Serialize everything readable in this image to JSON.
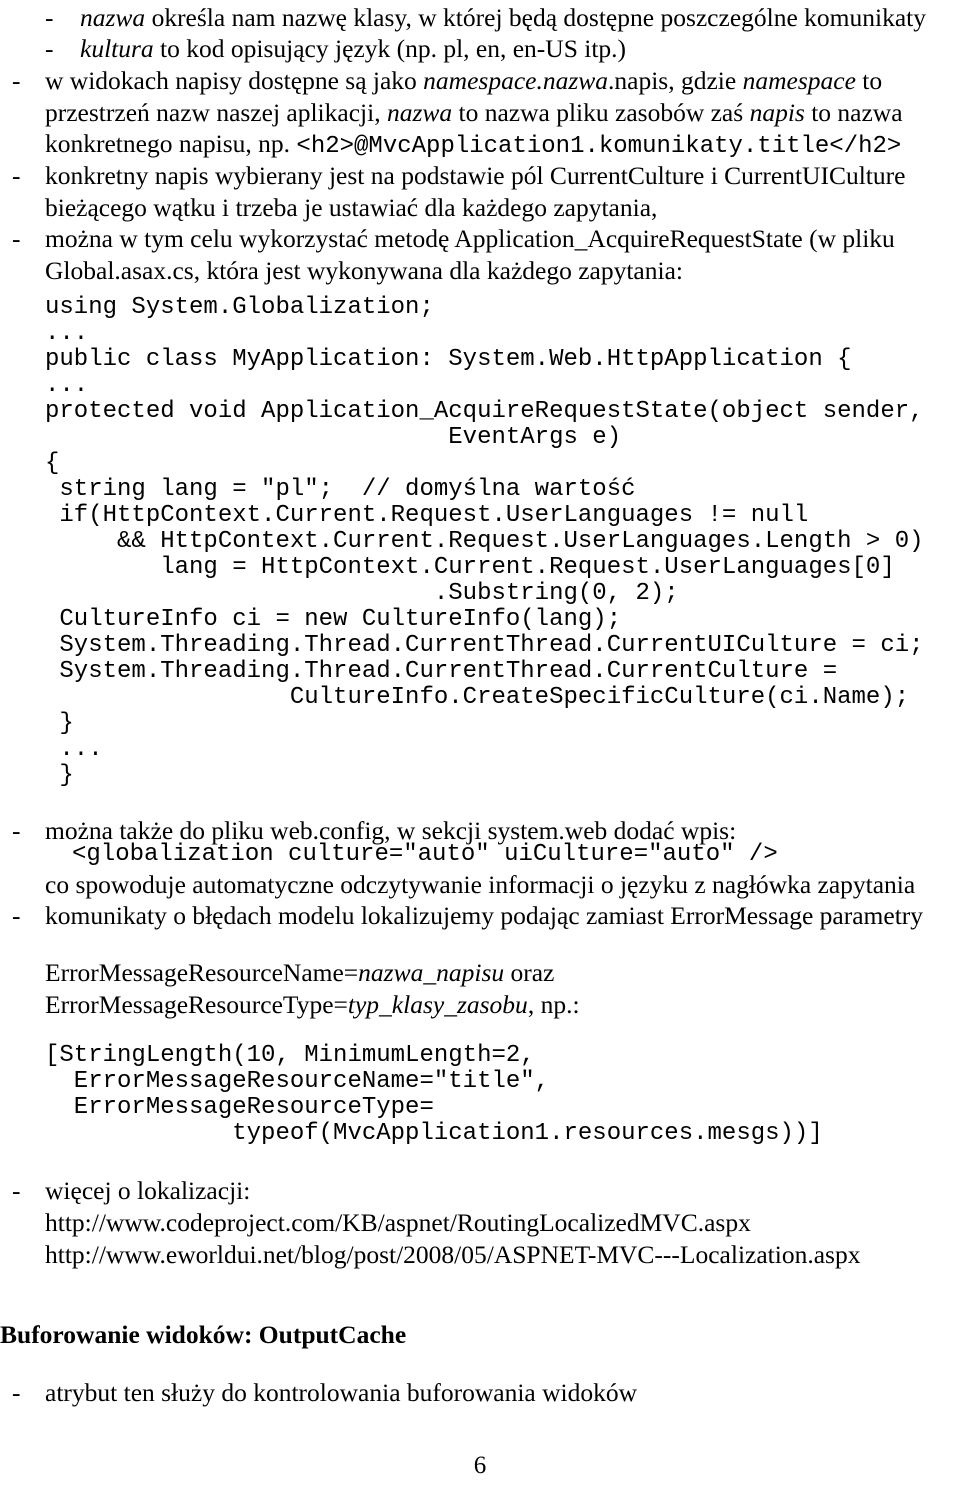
{
  "page": {
    "number": "6",
    "language": "pl"
  },
  "blocks": {
    "b1": {
      "dash": "-",
      "em1": "nazwa",
      "rest": " określa nam nazwę klasy, w której będą dostępne poszczególne komunikaty"
    },
    "b2": {
      "dash": "-",
      "em1": "kultura",
      "rest": " to kod opisujący język (np. pl, en, en-US itp.)"
    },
    "b3": {
      "dash": "-",
      "part1": "w widokach napisy dostępne są jako ",
      "em1": "namespace.nazwa",
      "part2": ".napis, gdzie ",
      "em2": "namespace",
      "part3": " to przestrzeń nazw naszej aplikacji, ",
      "em3": "nazwa",
      "part4": " to nazwa pliku zasobów zaś ",
      "em4": "napis",
      "part5": " to nazwa konkretnego napisu, np. ",
      "code1": "<h2>@MvcApplication1.komunikaty.title</h2>"
    },
    "b4": {
      "dash": "-",
      "text": "konkretny napis wybierany jest na podstawie pól CurrentCulture i CurrentUICulture bieżącego wątku i trzeba je ustawiać dla każdego zapytania,"
    },
    "b5": {
      "dash": "-",
      "text": "można w tym celu wykorzystać metodę Application_AcquireRequestState (w pliku Global.asax.cs, która jest wykonywana dla każdego zapytania:"
    },
    "code_block_1": {
      "lines": [
        "using System.Globalization;",
        "...",
        "public class MyApplication: System.Web.HttpApplication {",
        "...",
        "protected void Application_AcquireRequestState(object sender,",
        "                            EventArgs e)",
        "{",
        " string lang = \"pl\";  // domyślna wartość",
        " if(HttpContext.Current.Request.UserLanguages != null",
        "     && HttpContext.Current.Request.UserLanguages.Length > 0)",
        "        lang = HttpContext.Current.Request.UserLanguages[0]",
        "                           .Substring(0, 2);",
        " CultureInfo ci = new CultureInfo(lang);",
        " System.Threading.Thread.CurrentThread.CurrentUICulture = ci;",
        " System.Threading.Thread.CurrentThread.CurrentCulture =",
        "                 CultureInfo.CreateSpecificCulture(ci.Name);",
        " }",
        " ...",
        " }"
      ]
    },
    "b6": {
      "dash": "-",
      "text": "można także do pliku web.config, w sekcji system.web dodać wpis:"
    },
    "code_inline_1": "<globalization culture=\"auto\" uiCulture=\"auto\" />",
    "b6_after": "co spowoduje automatyczne odczytywanie informacji o języku z nagłówka zapytania",
    "b7": {
      "dash": "-",
      "text": "komunikaty o błędach modelu lokalizujemy podając zamiast ErrorMessage parametry"
    },
    "params": {
      "line1_pre": "ErrorMessageResourceName=",
      "line1_em": "nazwa_napisu",
      "line1_post": " oraz",
      "line2_pre": "ErrorMessageResourceType=",
      "line2_em": "typ_klasy_zasobu",
      "line2_post": ", np.:"
    },
    "code_block_2": {
      "lines": [
        "[StringLength(10, MinimumLength=2,",
        "  ErrorMessageResourceName=\"title\",",
        "  ErrorMessageResourceType=",
        "             typeof(MvcApplication1.resources.mesgs))]"
      ]
    },
    "b8": {
      "dash": "-",
      "text": "więcej o lokalizacji:"
    },
    "links": [
      "http://www.codeproject.com/KB/aspnet/RoutingLocalizedMVC.aspx",
      "http://www.eworldui.net/blog/post/2008/05/ASPNET-MVC---Localization.aspx"
    ],
    "section_heading": "Buforowanie widoków: OutputCache",
    "b9": {
      "dash": "-",
      "text": "atrybut ten służy do kontrolowania buforowania widoków"
    }
  }
}
